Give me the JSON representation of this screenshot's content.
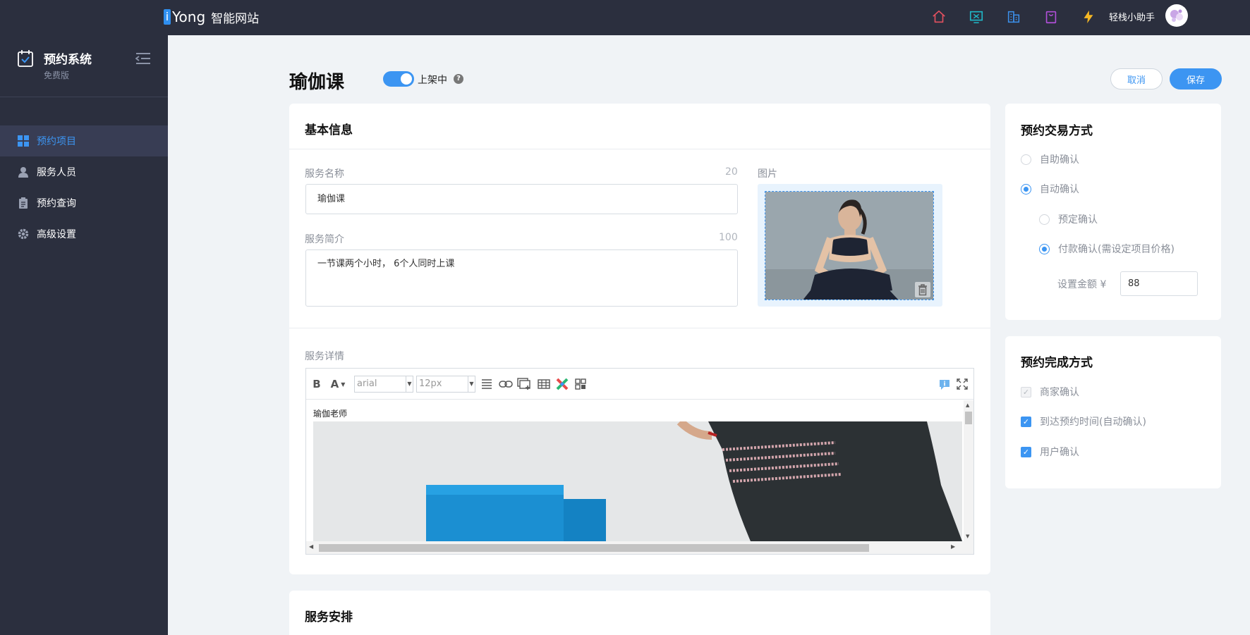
{
  "topbar": {
    "logo_i": "i",
    "logo_text": "Yong",
    "logo_cn": "智能网站",
    "icons": [
      "home-icon",
      "monitor-icon",
      "building-icon",
      "shopping-bag-icon",
      "lightning-icon"
    ],
    "assistant_label": "轻栈小助手"
  },
  "sidebar": {
    "title": "预约系统",
    "subtitle": "免费版",
    "items": [
      {
        "label": "预约项目",
        "icon": "grid-icon",
        "active": true
      },
      {
        "label": "服务人员",
        "icon": "person-icon",
        "active": false
      },
      {
        "label": "预约查询",
        "icon": "clipboard-icon",
        "active": false
      },
      {
        "label": "高级设置",
        "icon": "gear-icon",
        "active": false
      }
    ]
  },
  "header": {
    "title": "瑜伽课",
    "status_label": "上架中",
    "help": "?",
    "cancel_label": "取消",
    "save_label": "保存"
  },
  "basic": {
    "title": "基本信息",
    "name_label": "服务名称",
    "name_count": "20",
    "name_value": "瑜伽课",
    "intro_label": "服务简介",
    "intro_count": "100",
    "intro_value": "一节课两个小时， 6个人同时上课",
    "image_label": "图片",
    "detail_label": "服务详情",
    "editor_text": "瑜伽老师",
    "font_family": "arial",
    "font_size": "12px",
    "bold": "B",
    "font_color": "A"
  },
  "trade": {
    "title": "预约交易方式",
    "options": [
      "自助确认",
      "自动确认",
      "预定确认",
      "付款确认(需设定项目价格)"
    ],
    "amount_label": "设置金额 ¥",
    "amount_value": "88"
  },
  "done": {
    "title": "预约完成方式",
    "options": [
      "商家确认",
      "到达预约时间(自动确认)",
      "用户确认"
    ]
  },
  "arrange": {
    "title": "服务安排"
  },
  "colors": {
    "accent": "#3c95f2",
    "sidebar_bg": "#2b2f3e",
    "page_bg": "#f0f3f6"
  }
}
